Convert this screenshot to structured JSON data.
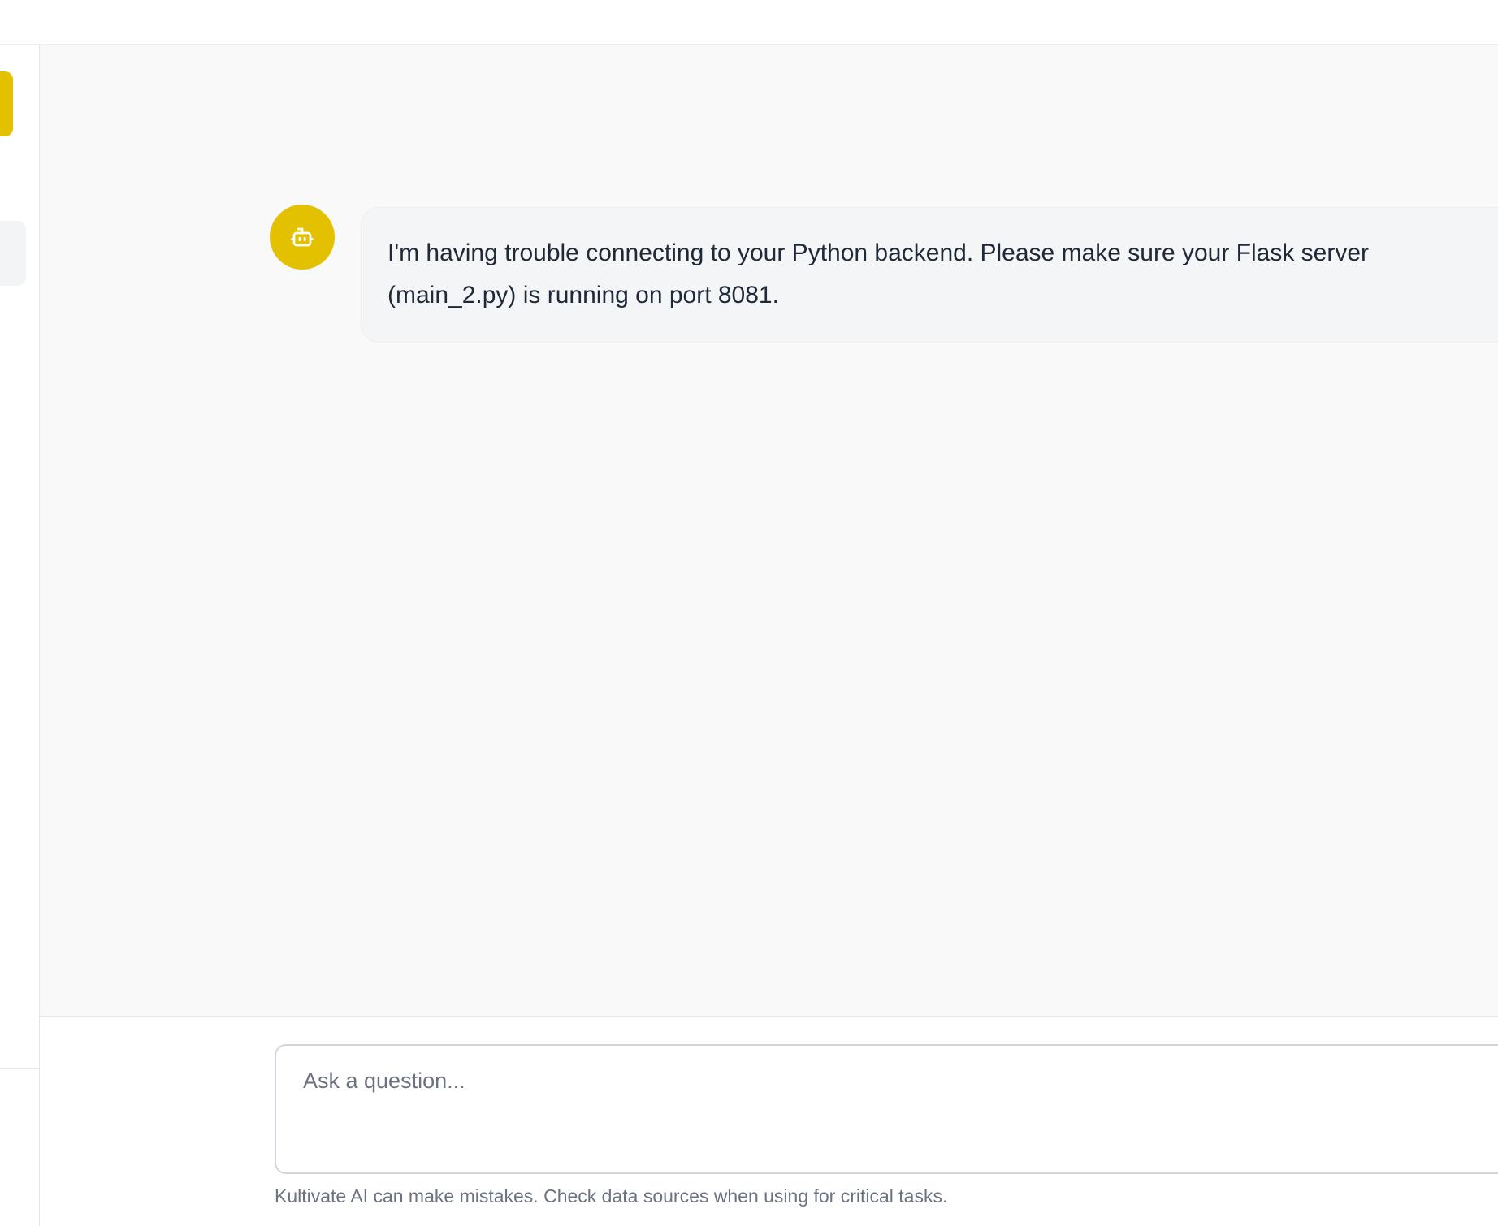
{
  "messages": [
    {
      "role": "assistant",
      "avatar_icon": "robot-icon",
      "text": "I'm having trouble connecting to your Python backend. Please make sure your Flask server (main_2.py) is running on port 8081."
    }
  ],
  "composer": {
    "placeholder": "Ask a question...",
    "value": ""
  },
  "footer": {
    "disclaimer": "Kultivate AI can make mistakes. Check data sources when using for critical tasks."
  },
  "colors": {
    "accent": "#e3c000",
    "chat_background": "#f9f9fa",
    "bubble_background": "#f4f5f7"
  }
}
